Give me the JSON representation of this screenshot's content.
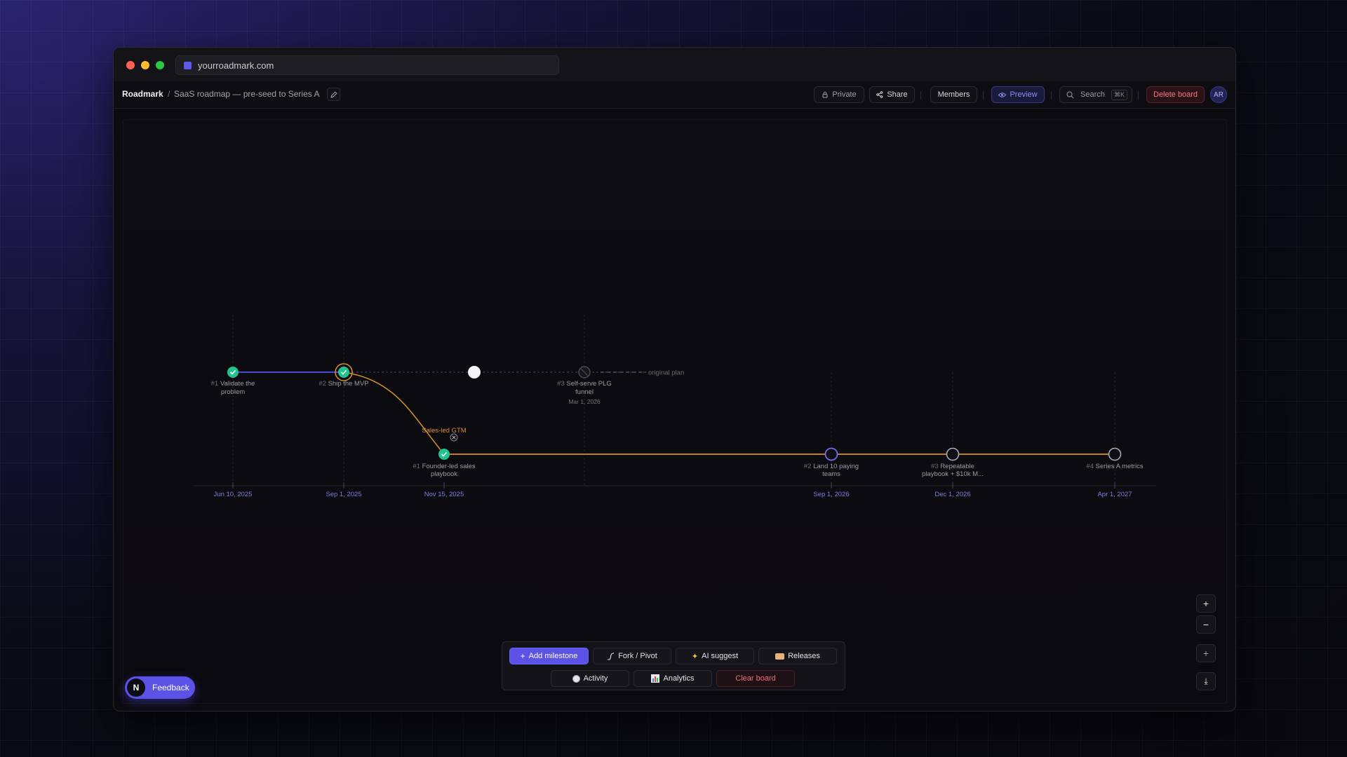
{
  "browser": {
    "url": "yourroadmark.com"
  },
  "header": {
    "brand": "Roadmark",
    "separator": "/",
    "board_title": "SaaS roadmap — pre-seed to Series A",
    "private_label": "Private",
    "share_label": "Share",
    "members_label": "Members",
    "preview_label": "Preview",
    "search_label": "Search",
    "search_shortcut": "⌘K",
    "delete_label": "Delete board",
    "avatar_initials": "AR"
  },
  "timeline": {
    "original_plan_label": "original plan",
    "branch_label": "Sales-led GTM",
    "dates": [
      "Jun 10, 2025",
      "Sep 1, 2025",
      "Nov 15, 2025",
      "Sep 1, 2026",
      "Dec 1, 2026",
      "Apr 1, 2027"
    ],
    "main_milestones": [
      {
        "num": "#1",
        "line1": "Validate the",
        "line2": "problem",
        "status": "done"
      },
      {
        "num": "#2",
        "line1": "Ship the MVP",
        "line2": "",
        "status": "done"
      },
      {
        "num": "",
        "line1": "",
        "line2": "",
        "status": "current"
      },
      {
        "num": "#3",
        "line1": "Self-serve PLG",
        "line2": "funnel",
        "status": "abandoned",
        "date": "Mar 1, 2026"
      }
    ],
    "branch_milestones": [
      {
        "num": "#1",
        "line1": "Founder-led sales",
        "line2": "playbook",
        "status": "done"
      },
      {
        "num": "#2",
        "line1": "Land 10 paying",
        "line2": "teams",
        "status": "in-progress"
      },
      {
        "num": "#3",
        "line1": "Repeatable",
        "line2": "playbook + $10k M...",
        "status": "planned"
      },
      {
        "num": "#4",
        "line1": "Series A metrics",
        "line2": "",
        "status": "planned"
      }
    ]
  },
  "actions": {
    "add_milestone": "Add milestone",
    "fork_pivot": "Fork / Pivot",
    "ai_suggest": "AI suggest",
    "releases": "Releases",
    "activity": "Activity",
    "analytics": "Analytics",
    "clear_board": "Clear board"
  },
  "zoom": {
    "in": "+",
    "out": "−",
    "fit": "+",
    "download": "⤓"
  },
  "feedback": {
    "initial": "N",
    "label": "Feedback"
  },
  "colors": {
    "accent": "#5b52e8",
    "done": "#22c38e",
    "branch": "#d9902a",
    "main_line": "#4b4bd6",
    "danger": "#e0525a"
  }
}
